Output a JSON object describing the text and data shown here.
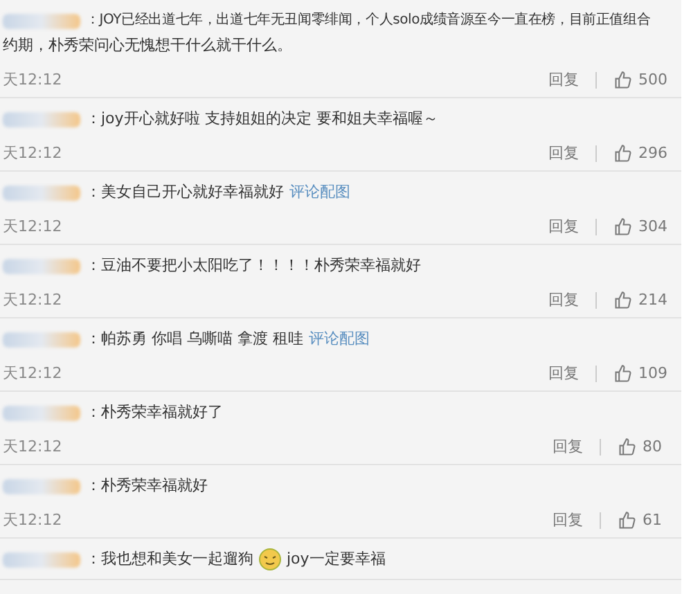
{
  "comments": [
    {
      "segments": [
        {
          "kind": "text",
          "text": "：JOY已经出道七年，出道七年无丑闻零绯闻，个人solo成绩音源至今一直在榜，目前正值组合"
        },
        {
          "kind": "text",
          "text": "约期，朴秀荣问心无愧想干什么就干什么。"
        }
      ],
      "time": "天12:12",
      "reply": "回复",
      "likes": "500"
    },
    {
      "segments": [
        {
          "kind": "text",
          "text": "：joy开心就好啦 支持姐姐的决定 要和姐夫幸福喔～"
        }
      ],
      "time": "天12:12",
      "reply": "回复",
      "likes": "296"
    },
    {
      "segments": [
        {
          "kind": "text",
          "text": "：美女自己开心就好幸福就好"
        },
        {
          "kind": "link",
          "text": "评论配图"
        }
      ],
      "time": "天12:12",
      "reply": "回复",
      "likes": "304"
    },
    {
      "segments": [
        {
          "kind": "text",
          "text": "：豆油不要把小太阳吃了！！！！朴秀荣幸福就好"
        }
      ],
      "time": "天12:12",
      "reply": "回复",
      "likes": "214"
    },
    {
      "segments": [
        {
          "kind": "text",
          "text": "：帕苏勇 你唱 乌嘶喵 拿渡 租哇"
        },
        {
          "kind": "link",
          "text": "评论配图"
        }
      ],
      "time": "天12:12",
      "reply": "回复",
      "likes": "109"
    },
    {
      "segments": [
        {
          "kind": "text",
          "text": "：朴秀荣幸福就好了"
        }
      ],
      "time": "天12:12",
      "reply": "回复",
      "likes": "80"
    },
    {
      "segments": [
        {
          "kind": "text",
          "text": "：朴秀荣幸福就好"
        }
      ],
      "time": "天12:12",
      "reply": "回复",
      "likes": "61"
    },
    {
      "segments": [
        {
          "kind": "text",
          "text": "：我也想和美女一起遛狗"
        },
        {
          "kind": "emoji"
        },
        {
          "kind": "text",
          "text": "joy一定要幸福"
        }
      ]
    }
  ]
}
